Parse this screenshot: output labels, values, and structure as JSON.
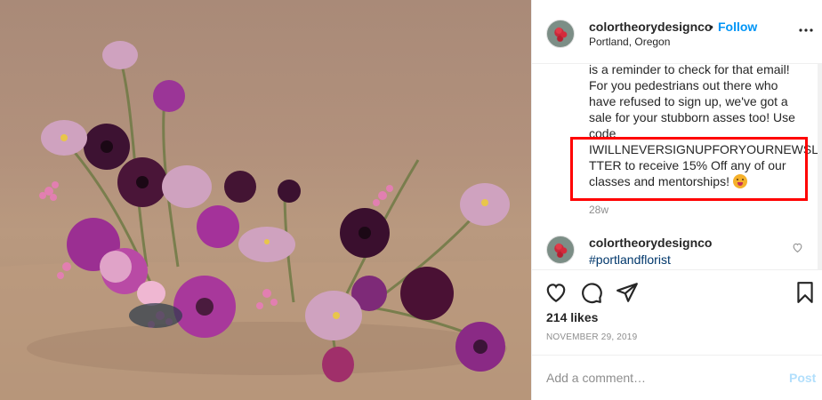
{
  "post": {
    "author": "colortheorydesignco",
    "separator": "•",
    "follow_label": "Follow",
    "location": "Portland, Oregon",
    "image_alt_icon": "floral-arrangement-photo"
  },
  "caption": {
    "lines": [
      "is a reminder to check for that email!",
      "For you pedestrians out there who",
      "have refused to sign up, we've got a",
      "sale for your stubborn asses too! Use",
      "code",
      "IWILLNEVERSIGNUPFORYOURNEWSLE",
      "TTER to receive 15% Off any of our",
      "classes and mentorships!"
    ],
    "time": "28w"
  },
  "comment": {
    "author": "colortheorydesignco",
    "text": "#portlandflorist"
  },
  "stats": {
    "likes": "214 likes",
    "date": "NOVEMBER 29, 2019"
  },
  "composer": {
    "placeholder": "Add a comment…",
    "post_label": "Post"
  },
  "colors": {
    "link_blue": "#0095f6",
    "highlight_red": "#ff0000",
    "post_disabled": "#b2dffc"
  }
}
